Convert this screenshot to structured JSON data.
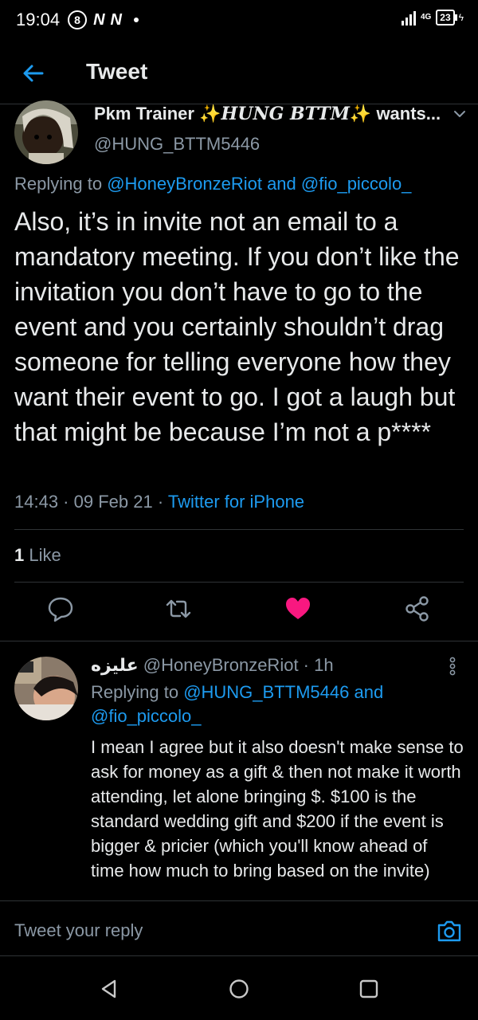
{
  "status_bar": {
    "time": "19:04",
    "icon_circle": "8",
    "icon_n1": "N",
    "icon_n2": "N",
    "network": "4G",
    "battery": "23"
  },
  "header": {
    "title": "Tweet"
  },
  "tweet": {
    "author_name_a": "Pkm Trainer ",
    "author_name_fancy": "HUNG BTTM",
    "author_name_b": " wants...",
    "author_handle": "@HUNG_BTTM5446",
    "replying_prefix": "Replying to ",
    "replying_user1": "@HoneyBronzeRiot",
    "replying_and": " and ",
    "replying_user2": "@fio_piccolo_",
    "text": "Also, it’s in invite not an email to a mandatory meeting. If you don’t like the invitation you don’t have to go to the event and you certainly shouldn’t drag someone for telling everyone how they want their event to go. I got a laugh but that might be because I’m not a p****",
    "time": "14:43",
    "date": "09 Feb 21",
    "source": "Twitter for iPhone",
    "likes_count": "1",
    "likes_label": "Like",
    "liked": true,
    "like_color": "#f91880"
  },
  "reply": {
    "author_name": "عليزه",
    "author_handle": "@HoneyBronzeRiot",
    "time_ago": "1h",
    "replying_prefix": "Replying to ",
    "replying_user1": "@HUNG_BTTM5446",
    "replying_and": " and",
    "replying_user2": "@fio_piccolo_",
    "text": "I mean I agree but it also doesn't make sense to ask for money as a gift & then not make it worth attending, let alone bringing $. $100 is the standard wedding gift and $200 if the event is bigger & pricier (which you'll know ahead of time how much to bring based on the invite)"
  },
  "compose": {
    "placeholder": "Tweet your reply"
  },
  "colors": {
    "accent": "#1d9bf0",
    "secondary_text": "#8b98a5",
    "background": "#000000"
  }
}
